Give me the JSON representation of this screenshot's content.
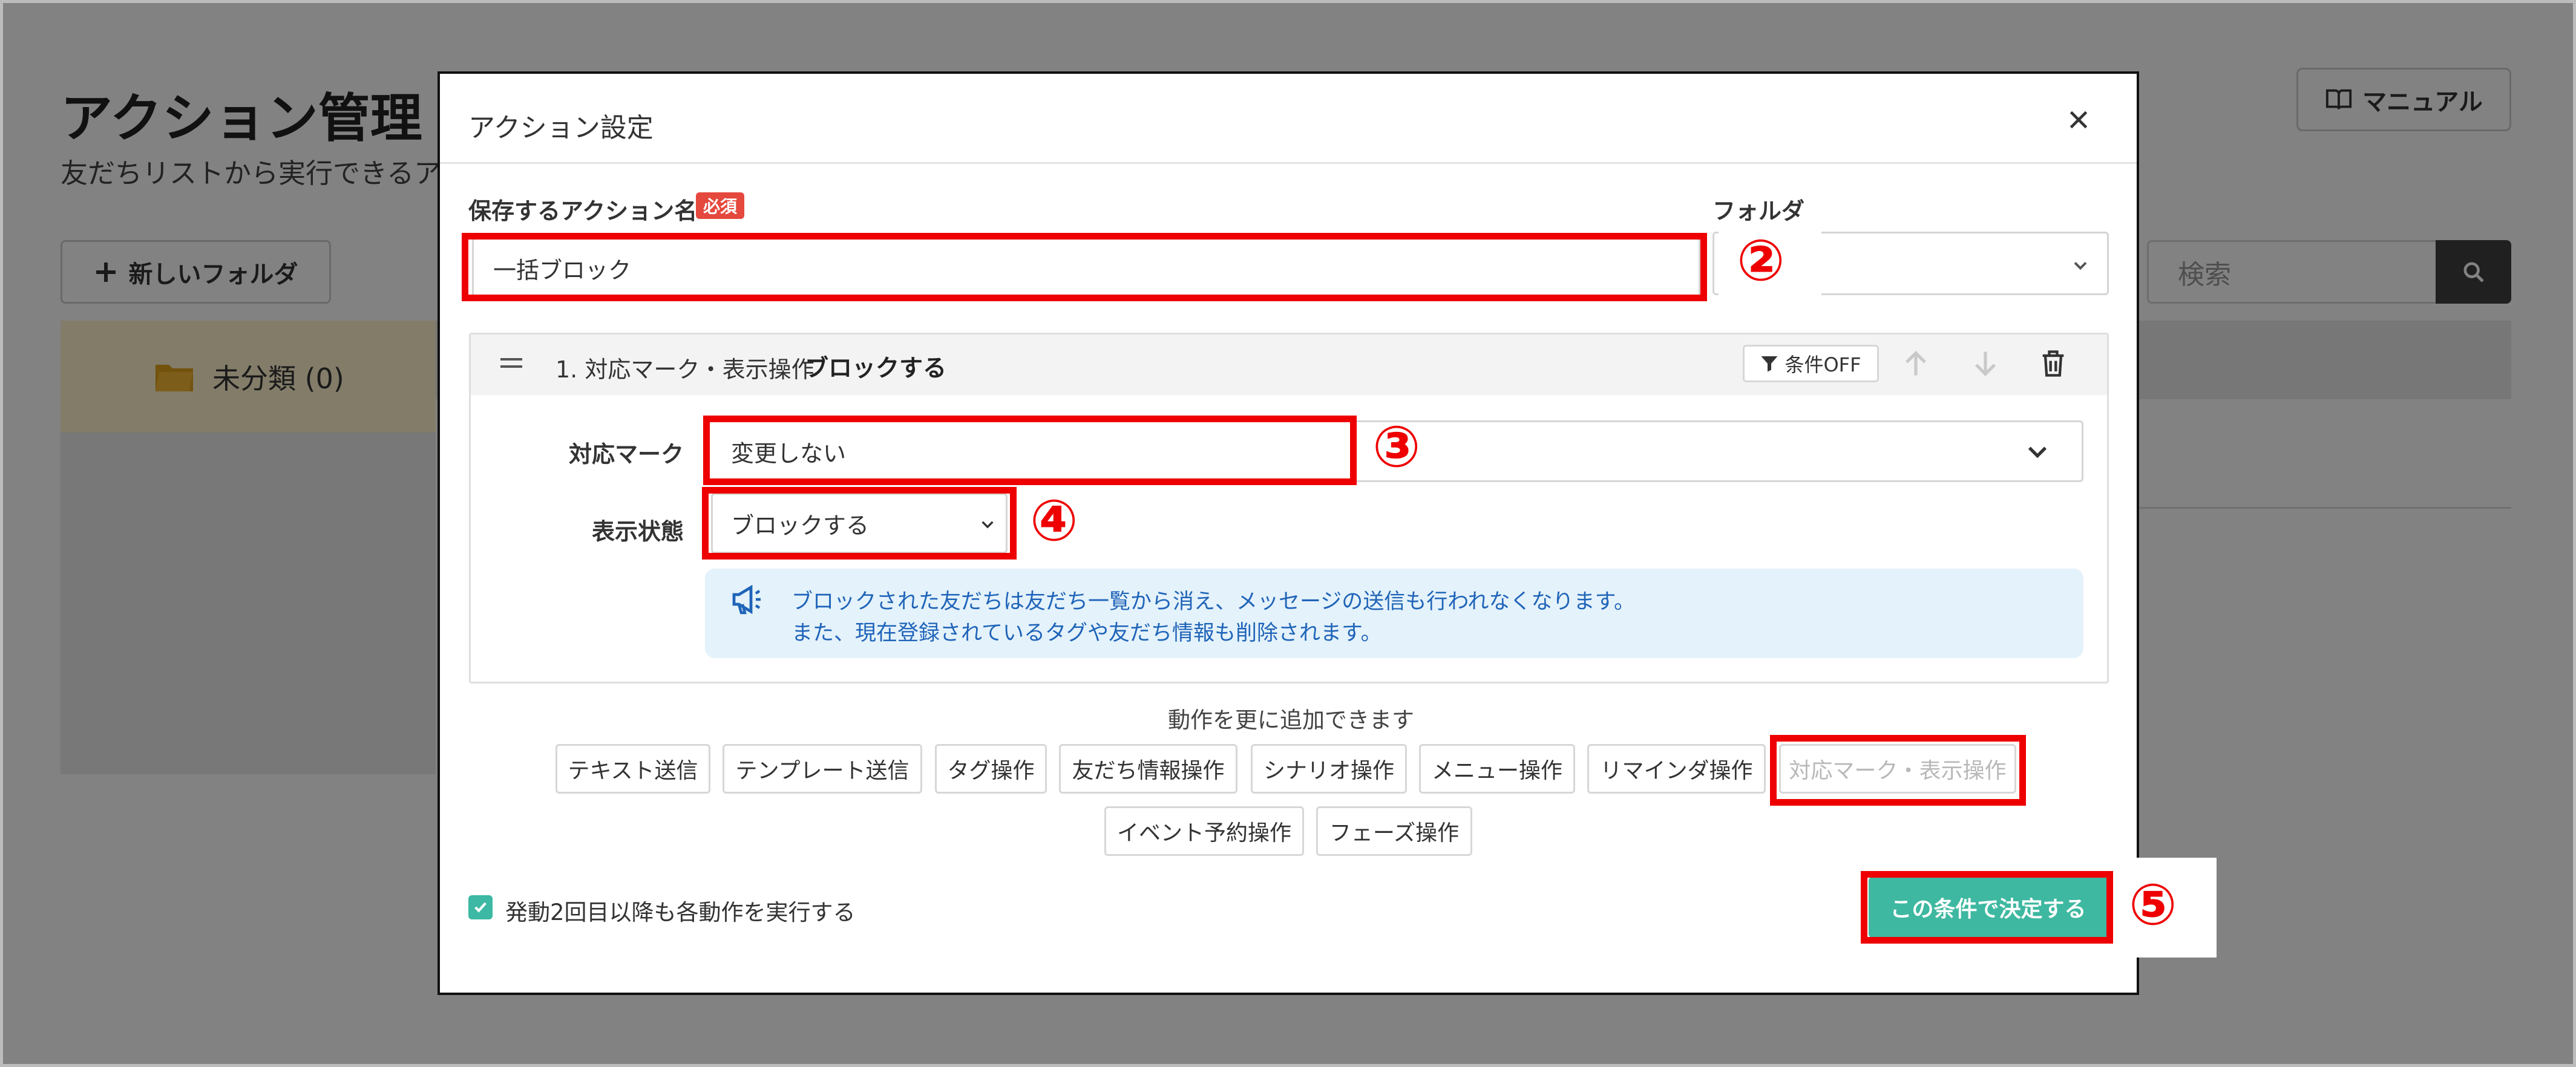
{
  "page": {
    "title": "アクション管理",
    "description": "友だちリストから実行できるア",
    "manual_label": "マニュアル",
    "new_folder_label": "新しいフォルダ",
    "search_placeholder": "検索",
    "folder_item_label": "未分類 (0)"
  },
  "modal": {
    "title": "アクション設定",
    "close_label": "×",
    "action_name_label": "保存するアクション名",
    "required_label": "必須",
    "folder_label": "フォルダ",
    "action_name_value": "一括ブロック",
    "folder_value": "",
    "card": {
      "title_num": "1. 対応マーク・表示操作",
      "title_value": "ブロックする",
      "condition_label": "条件OFF",
      "mark_label": "対応マーク",
      "mark_value": "変更しない",
      "display_label": "表示状態",
      "display_value": "ブロックする",
      "info_line1": "ブロックされた友だちは友だち一覧から消え、メッセージの送信も行われなくなります。",
      "info_line2": "また、現在登録されているタグや友だち情報も削除されます。"
    },
    "add_more_label": "動作を更に追加できます",
    "ops_row1": [
      "テキスト送信",
      "テンプレート送信",
      "タグ操作",
      "友だち情報操作",
      "シナリオ操作",
      "メニュー操作",
      "リマインダ操作",
      "対応マーク・表示操作"
    ],
    "ops_row2": [
      "イベント予約操作",
      "フェーズ操作"
    ],
    "repeat_label": "発動2回目以降も各動作を実行する",
    "repeat_checked": true,
    "confirm_label": "この条件で決定する"
  },
  "annotations": [
    "②",
    "③",
    "④",
    "⑤"
  ],
  "colors": {
    "accent": "#3eb8a0",
    "annotation_red": "#ee0000",
    "info_text": "#1f64b8",
    "info_bg": "#e4f2fb",
    "required_badge": "#e5483d"
  }
}
